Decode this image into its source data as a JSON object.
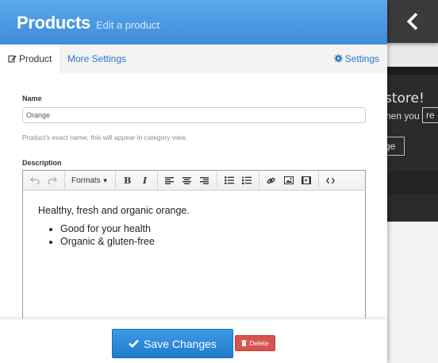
{
  "header": {
    "title": "Products",
    "subtitle": "Edit a product"
  },
  "tabs": [
    {
      "label": "Product",
      "icon": "edit-icon",
      "active": true
    },
    {
      "label": "More Settings",
      "active": false
    },
    {
      "label": "Settings",
      "icon": "gear-icon",
      "active": false
    }
  ],
  "form": {
    "name_label": "Name",
    "name_value": "Orange",
    "name_help": "Product's exact name, this will appear in category view.",
    "description_label": "Description",
    "editor": {
      "toolbar": {
        "formats_label": "Formats",
        "bold": "B",
        "italic": "I"
      },
      "paragraph": "Healthy, fresh and organic orange.",
      "bullets": [
        "Good for your health",
        "Organic & gluten-free"
      ]
    }
  },
  "footer": {
    "save_label": "Save Changes",
    "delete_label": "Delete"
  },
  "background": {
    "store_text": "store!",
    "when_text": "hen you",
    "input_text": "re",
    "button_text": "ge"
  },
  "colors": {
    "accent": "#3f8cdb",
    "link": "#2a78c5",
    "danger": "#d9534f",
    "dark_bg": "#2b2b2b"
  }
}
